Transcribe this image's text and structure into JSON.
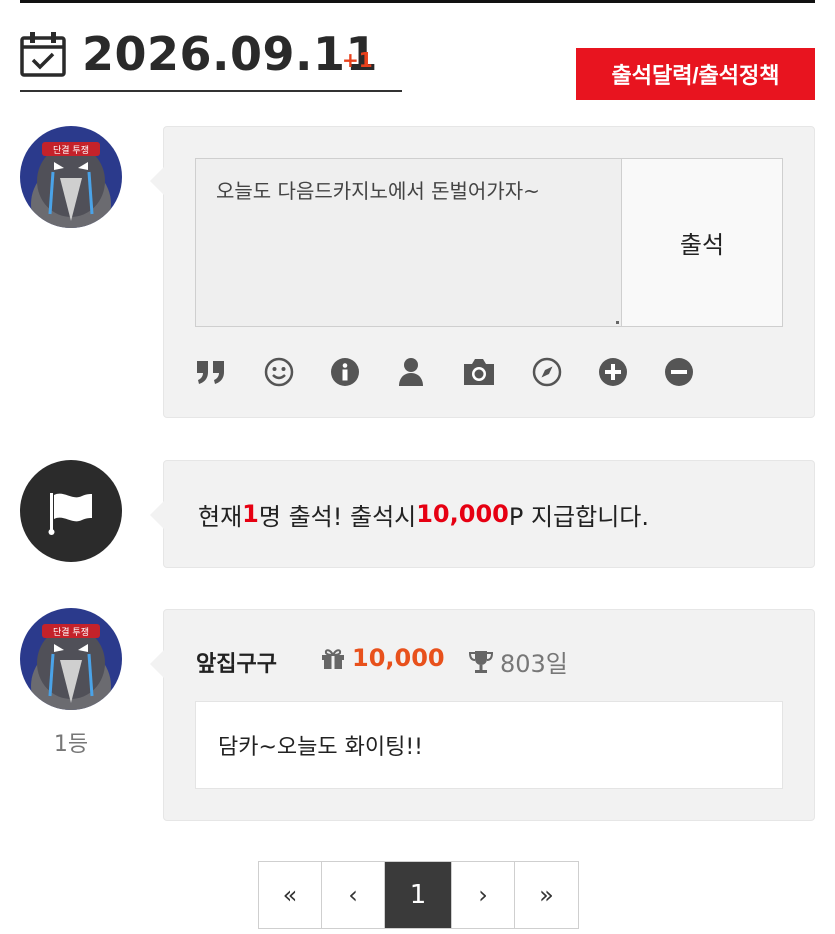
{
  "header": {
    "date": "2026.09.11",
    "count": "+1",
    "policy_button": "출석달력/출석정책"
  },
  "comment_form": {
    "text": "오늘도 다음드카지노에서 돈벌어가자~",
    "submit_label": "출석",
    "toolbar_icons": [
      "quote-icon",
      "smiley-icon",
      "info-icon",
      "user-icon",
      "camera-icon",
      "compass-icon",
      "plus-circle-icon",
      "minus-circle-icon"
    ]
  },
  "notice": {
    "prefix": "현재 ",
    "count": "1",
    "middle": "명 출석! 출석시 ",
    "points": "10,000",
    "suffix": "P 지급합니다."
  },
  "entry": {
    "name": "앞집구구",
    "points": "10,000",
    "days": "803일",
    "message": "담카~오늘도 화이팅!!",
    "rank": "1등"
  },
  "pagination": {
    "first": "«",
    "prev": "‹",
    "current": "1",
    "next": "›",
    "last": "»"
  },
  "colors": {
    "accent_red": "#e8141f",
    "points_orange": "#e8511c",
    "card_bg": "#f2f2f2"
  }
}
